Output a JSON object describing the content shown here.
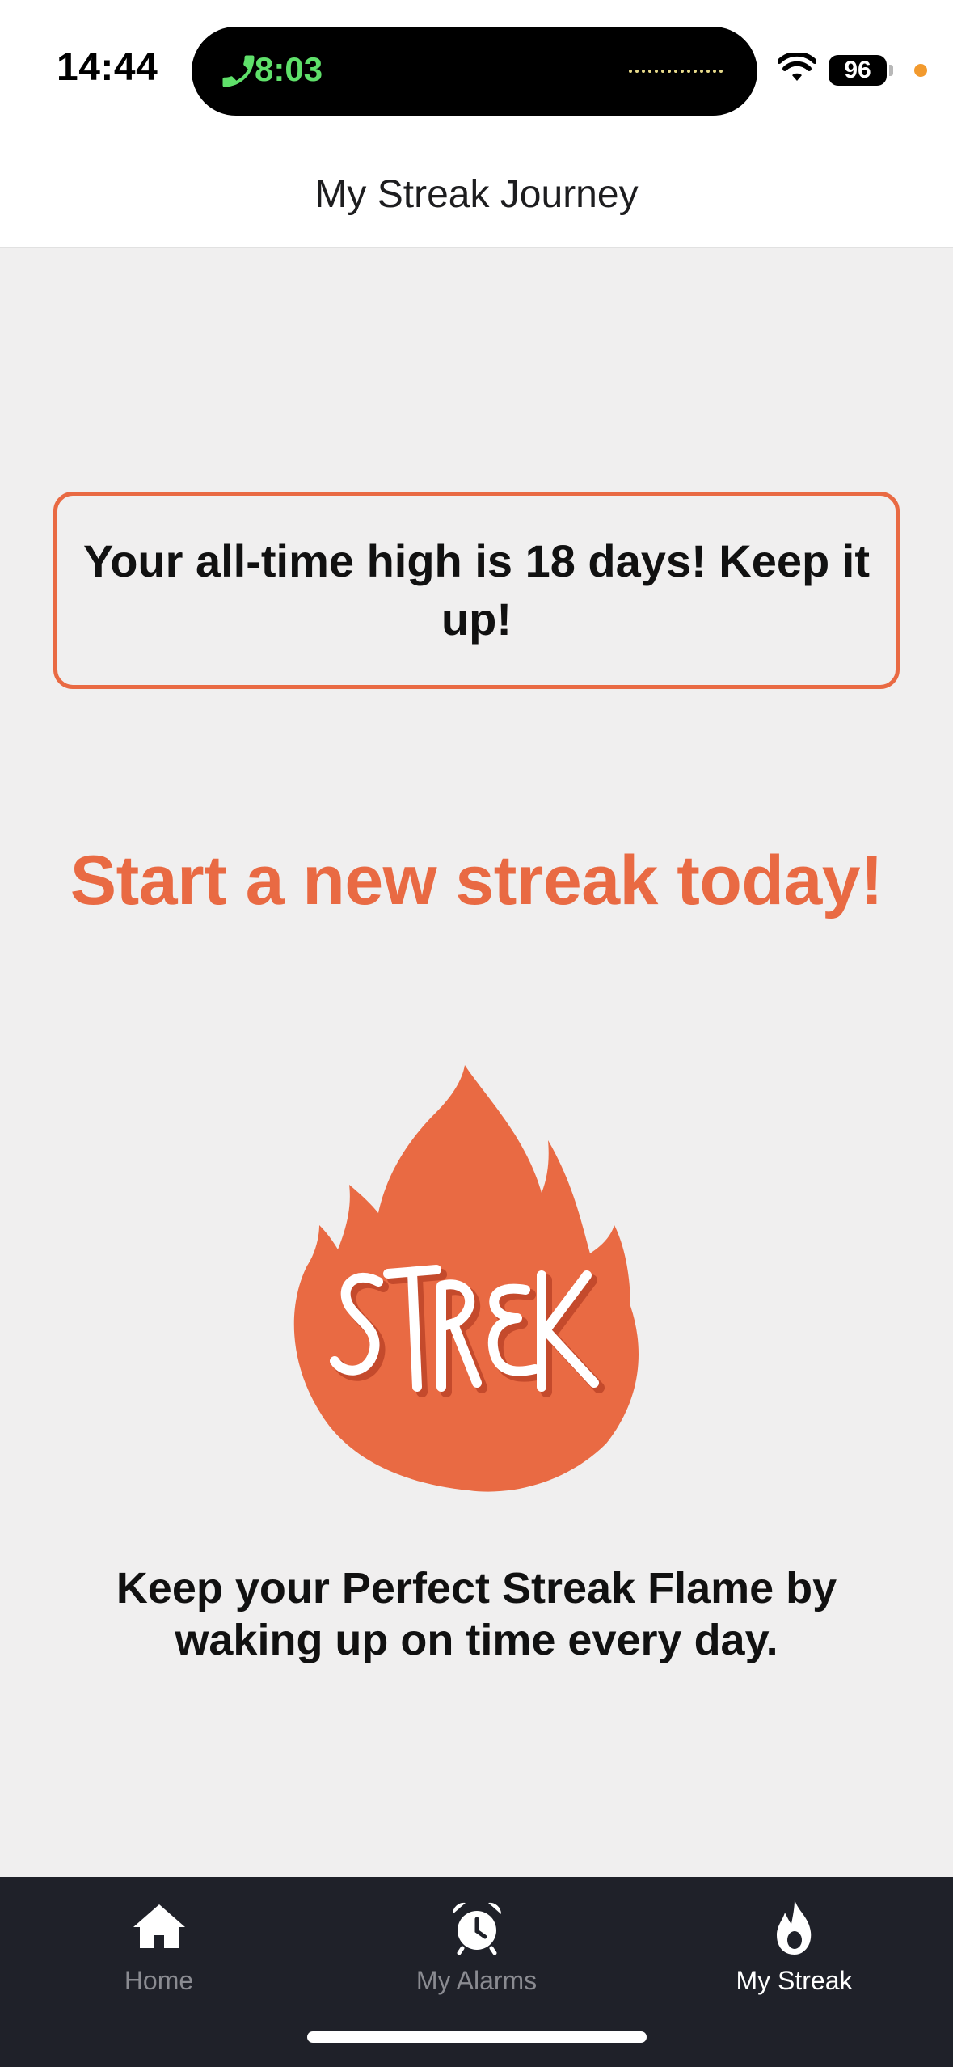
{
  "status_bar": {
    "time": "14:44",
    "call_duration": "8:03",
    "battery": "96"
  },
  "header": {
    "title": "My Streak Journey"
  },
  "main": {
    "record_message": "Your all-time high is 18 days! Keep it up!",
    "headline": "Start a new streak today!",
    "flame_text": "STREAK",
    "caption": "Keep your Perfect Streak Flame by waking up on time every day."
  },
  "tabs": [
    {
      "label": "Home",
      "icon": "home-icon",
      "active": false
    },
    {
      "label": "My Alarms",
      "icon": "alarm-clock-icon",
      "active": false
    },
    {
      "label": "My Streak",
      "icon": "flame-icon",
      "active": true
    }
  ],
  "colors": {
    "accent": "#e96a43",
    "call_green": "#5fe06a",
    "tab_bar": "#1f2129",
    "background": "#f0efef"
  }
}
